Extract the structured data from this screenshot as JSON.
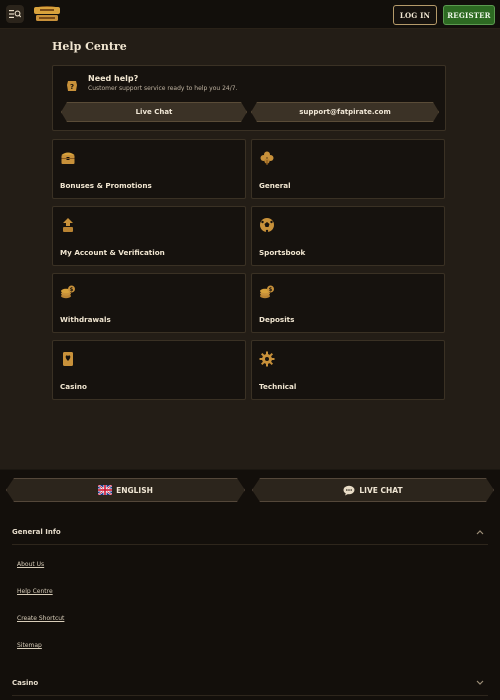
{
  "header": {
    "logo_alt": "FAT PIRATE",
    "login_label": "LOG IN",
    "register_label": "REGISTER"
  },
  "help": {
    "title": "Help Centre",
    "need_help_title": "Need help?",
    "need_help_sub": "Customer support service ready to help you 24/7.",
    "live_chat_label": "Live Chat",
    "email_label": "support@fatpirate.com"
  },
  "categories": [
    {
      "label": "Bonuses & Promotions",
      "icon": "treasure-chest-icon"
    },
    {
      "label": "General",
      "icon": "clover-icon"
    },
    {
      "label": "My Account & Verification",
      "icon": "user-upload-icon"
    },
    {
      "label": "Sportsbook",
      "icon": "soccer-ball-icon"
    },
    {
      "label": "Withdrawals",
      "icon": "coins-icon"
    },
    {
      "label": "Deposits",
      "icon": "coins-icon"
    },
    {
      "label": "Casino",
      "icon": "playing-card-icon"
    },
    {
      "label": "Technical",
      "icon": "gear-icon"
    }
  ],
  "footer": {
    "language_label": "ENGLISH",
    "live_chat_label": "LIVE CHAT",
    "general_info": {
      "title": "General Info",
      "links": [
        "About Us",
        "Help Centre",
        "Create Shortcut",
        "Sitemap"
      ]
    },
    "casino_title": "Casino"
  },
  "colors": {
    "accent_gold": "#c8913a",
    "register_green": "#2d6a22",
    "background": "#231d16"
  }
}
